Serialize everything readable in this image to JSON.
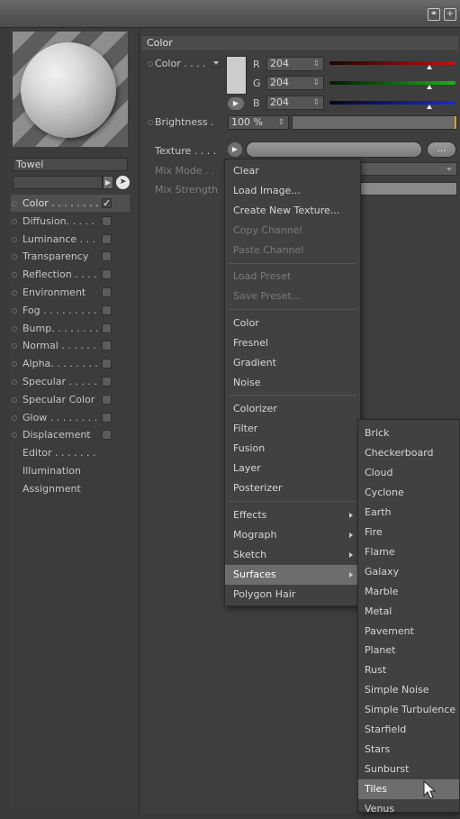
{
  "material": {
    "name": "Towel"
  },
  "channels": [
    {
      "label": "Color . . . . . . . .",
      "checked": true
    },
    {
      "label": "Diffusion. . . . .",
      "checked": false
    },
    {
      "label": "Luminance . . .",
      "checked": false
    },
    {
      "label": "Transparency",
      "checked": false
    },
    {
      "label": "Reflection . . . .",
      "checked": false
    },
    {
      "label": "Environment",
      "checked": false
    },
    {
      "label": "Fog . . . . . . . . .",
      "checked": false
    },
    {
      "label": "Bump. . . . . . . .",
      "checked": false
    },
    {
      "label": "Normal . . . . . .",
      "checked": false
    },
    {
      "label": "Alpha. . . . . . . .",
      "checked": false
    },
    {
      "label": "Specular . . . . .",
      "checked": false
    },
    {
      "label": "Specular Color",
      "checked": false
    },
    {
      "label": "Glow . . . . . . . .",
      "checked": false
    },
    {
      "label": "Displacement",
      "checked": false
    }
  ],
  "extra_items": [
    "Editor . . . . . . .",
    "Illumination",
    "Assignment"
  ],
  "section": {
    "title": "Color"
  },
  "color": {
    "label": "Color . . . .",
    "r_label": "R",
    "g_label": "G",
    "b_label": "B",
    "r": "204",
    "g": "204",
    "b": "204",
    "swatch": "#cccccc"
  },
  "brightness": {
    "label": "Brightness .",
    "value": "100 %"
  },
  "texture": {
    "label": "Texture . . . .",
    "more_label": "..."
  },
  "mix_mode": {
    "label": "Mix Mode . ."
  },
  "mix_strength": {
    "label": "Mix Strength"
  },
  "context_menu": [
    {
      "label": "Clear"
    },
    {
      "label": "Load Image..."
    },
    {
      "label": "Create New Texture..."
    },
    {
      "label": "Copy Channel",
      "disabled": true
    },
    {
      "label": "Paste Channel",
      "disabled": true
    },
    {
      "label": "Load Preset",
      "disabled": true
    },
    {
      "label": "Save Preset...",
      "disabled": true
    },
    {
      "label": "Color"
    },
    {
      "label": "Fresnel"
    },
    {
      "label": "Gradient"
    },
    {
      "label": "Noise"
    },
    {
      "label": "Colorizer"
    },
    {
      "label": "Filter"
    },
    {
      "label": "Fusion"
    },
    {
      "label": "Layer"
    },
    {
      "label": "Posterizer"
    },
    {
      "label": "Effects",
      "submenu": true
    },
    {
      "label": "Mograph",
      "submenu": true
    },
    {
      "label": "Sketch",
      "submenu": true
    },
    {
      "label": "Surfaces",
      "submenu": true,
      "highlighted": true
    },
    {
      "label": "Polygon Hair"
    }
  ],
  "surfaces_menu": [
    "Brick",
    "Checkerboard",
    "Cloud",
    "Cyclone",
    "Earth",
    "Fire",
    "Flame",
    "Galaxy",
    "Marble",
    "Metal",
    "Pavement",
    "Planet",
    "Rust",
    "Simple Noise",
    "Simple Turbulence",
    "Starfield",
    "Stars",
    "Sunburst",
    "Tiles",
    "Venus"
  ],
  "surfaces_selected": "Tiles",
  "colors": {
    "red_channel": "#c41010",
    "green_channel": "#17b317",
    "blue_channel": "#1c2bd0",
    "brightness_accent": "#d9a326"
  },
  "icons": [
    "lock-icon",
    "new-window-icon",
    "pointer-icon",
    "expand-arrow-icon",
    "submenu-arrow-icon"
  ]
}
